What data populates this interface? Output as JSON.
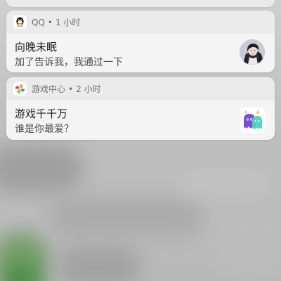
{
  "notifications": [
    {
      "app_name": "QQ",
      "time": "1 小时",
      "title": "向晚未眠",
      "message": "加了告诉我，我通过一下",
      "icon": "qq-penguin-icon"
    },
    {
      "app_name": "游戏中心",
      "time": "2 小时",
      "title": "游戏千千万",
      "message": "谁是你最爱？",
      "icon": "game-center-pinwheel-icon"
    }
  ],
  "separator": "•",
  "colors": {
    "card_background": "#f4f4f4",
    "header_background": "#ebebeb",
    "meta_text": "#6f6f6f",
    "title_text": "#1e1e1e",
    "message_text": "#4a4a4a",
    "game_ghost_purple": "#7a4ed6",
    "game_ghost_teal": "#4fd1b8"
  }
}
